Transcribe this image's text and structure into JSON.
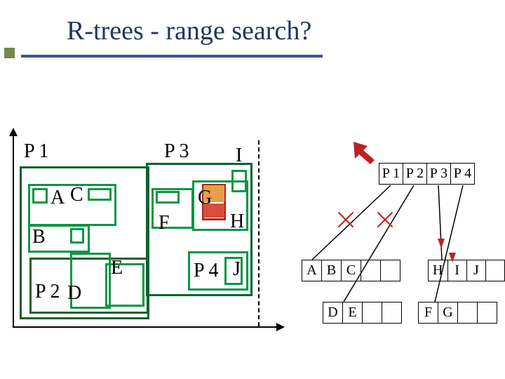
{
  "title": "R-trees - range search?",
  "spatial": {
    "P1": "P 1",
    "P2": "P 2",
    "P3": "P 3",
    "P4": "P 4",
    "A": "A",
    "B": "B",
    "C": "C",
    "D": "D",
    "E": "E",
    "F": "F",
    "G": "G",
    "H": "H",
    "I": "I",
    "J": "J"
  },
  "tree": {
    "root": [
      "P 1",
      "P 2",
      "P 3",
      "P 4"
    ],
    "n1": [
      "A",
      "B",
      "C",
      "",
      ""
    ],
    "n2": [
      "H",
      "I",
      "J",
      ""
    ],
    "n3": [
      "D",
      "E",
      "",
      ""
    ],
    "n4": [
      "F",
      "G",
      "",
      ""
    ]
  }
}
